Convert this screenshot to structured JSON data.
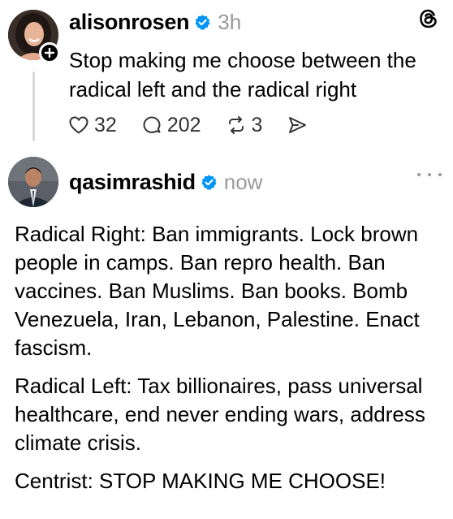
{
  "post1": {
    "username": "alisonrosen",
    "timestamp": "3h",
    "text": "Stop making me choose between the radical left and the radical right",
    "likes": "32",
    "replies": "202",
    "reposts": "3",
    "icons": {
      "verified": "verified-badge-icon",
      "follow": "plus-icon",
      "app": "threads-logo-icon",
      "like": "heart-icon",
      "reply": "comment-icon",
      "repost": "repost-icon",
      "share": "send-icon"
    }
  },
  "post2": {
    "username": "qasimrashid",
    "timestamp": "now",
    "paragraphs": [
      "Radical Right: Ban immigrants. Lock brown people in camps. Ban repro health. Ban vaccines. Ban Muslims. Ban books. Bomb Venezuela, Iran, Lebanon, Palestine. Enact fascism.",
      "Radical Left: Tax billionaires, pass universal healthcare, end never ending wars, address climate crisis.",
      "Centrist: STOP MAKING ME CHOOSE!"
    ],
    "icons": {
      "verified": "verified-badge-icon",
      "more": "more-options-icon"
    }
  },
  "colors": {
    "verified_blue": "#0095f6",
    "secondary_text": "#999999",
    "thread_line": "#d9d9d9"
  }
}
